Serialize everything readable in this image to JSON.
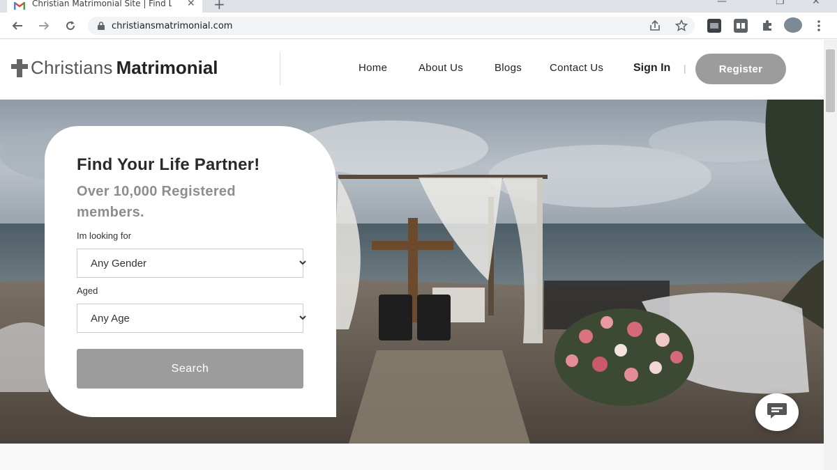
{
  "browser": {
    "tab_title": "Christian Matrimonial Site | Find L",
    "tab_close": "✕",
    "new_tab": "+",
    "url": "christiansmatrimonial.com"
  },
  "header": {
    "logo_light": "Christians",
    "logo_bold": "Matrimonial",
    "nav": [
      "Home",
      "About Us",
      "Blogs",
      "Contact Us"
    ],
    "signin": "Sign In",
    "separator": "|",
    "register": "Register"
  },
  "search": {
    "title": "Find Your Life Partner!",
    "subtitle": "Over 10,000 Registered members.",
    "looking_label": "Im looking for",
    "gender_value": "Any Gender",
    "aged_label": "Aged",
    "age_value": "Any Age",
    "button": "Search"
  },
  "colors": {
    "accent_gray": "#9c9c9c",
    "text_dark": "#222222"
  }
}
